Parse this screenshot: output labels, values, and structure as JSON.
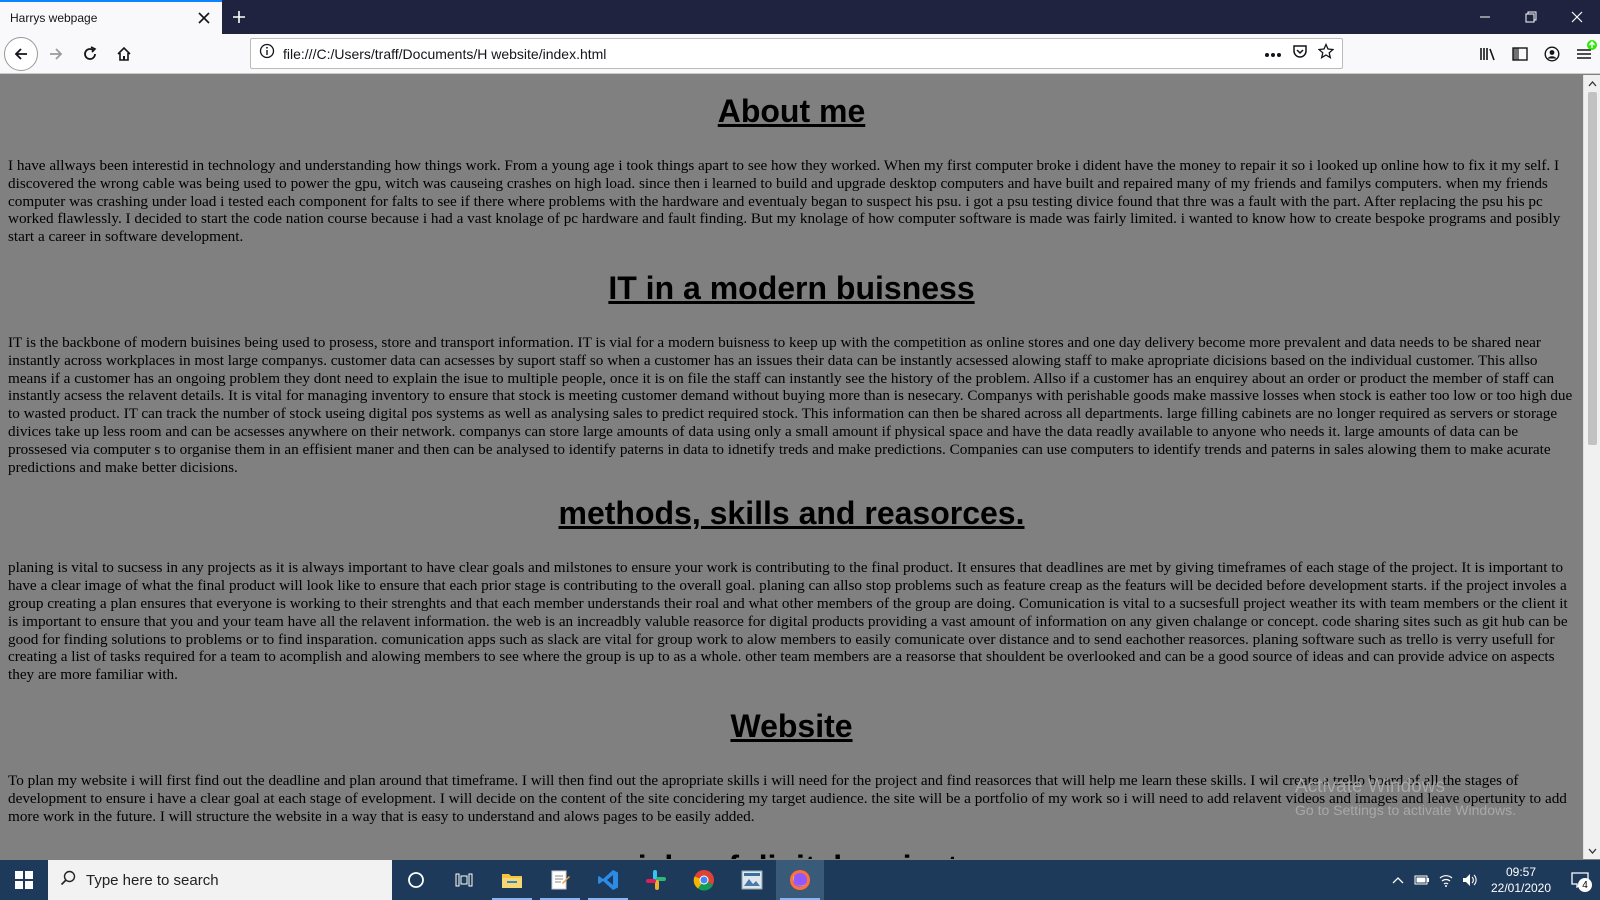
{
  "browser": {
    "tab_title": "Harrys webpage",
    "url": "file:///C:/Users/traff/Documents/H website/index.html"
  },
  "page": {
    "sections": [
      {
        "heading": "About me",
        "body": "I have allways been interestid in technology and understanding how things work. From a young age i took things apart to see how they worked. When my first computer broke i dident have the money to repair it so i looked up online how to fix it my self. I discovered the wrong cable was being used to power the gpu, witch was causeing crashes on high load. since then i learned to build and upgrade desktop computers and have built and repaired many of my friends and familys computers. when my friends computer was crashing under load i tested each component for falts to see if there where problems with the hardware and eventualy began to suspect his psu. i got a psu testing divice found that thre was a fault with the part. After replacing the psu his pc worked flawlessly. I decided to start the code nation course because i had a vast knolage of pc hardware and fault finding. But my knolage of how computer software is made was fairly limited. i wanted to know how to create bespoke programs and posibly start a career in software development."
      },
      {
        "heading": "IT in a modern buisness",
        "body": "IT is the backbone of modern buisines being used to prosess, store and transport information. IT is vial for a modern buisness to keep up with the competition as online stores and one day delivery become more prevalent and data needs to be shared near instantly across workplaces in most large companys. customer data can acsesses by suport staff so when a customer has an issues their data can be instantly acsessed alowing staff to make apropriate dicisions based on the individual customer. This allso means if a customer has an ongoing problem they dont need to explain the isue to multiple people, once it is on file the staff can instantly see the history of the problem. Allso if a customer has an enquirey about an order or product the member of staff can instantly acsess the relavent details. It is vital for managing inventory to ensure that stock is meeting customer demand without buying more than is nesecary. Companys with perishable goods make massive losses when stock is eather too low or too high due to wasted product. IT can track the number of stock useing digital pos systems as well as analysing sales to predict required stock. This information can then be shared across all departments. large filling cabinets are no longer required as servers or storage divices take up less room and can be acsesses anywhere on their network. companys can store large amounts of data using only a small amount if physical space and have the data readly available to anyone who needs it. large amounts of data can be prossesed via computer s to organise them in an effisient maner and then can be analysed to identify paterns in data to idnetify treds and make predictions. Companies can use computers to identify trends and paterns in sales alowing them to make acurate predictions and make better dicisions."
      },
      {
        "heading": "methods, skills and reasorces.",
        "body": "planing is vital to sucsess in any projects as it is always important to have clear goals and milstones to ensure your work is contributing to the final product. It ensures that deadlines are met by giving timeframes of each stage of the project. It is important to have a clear image of what the final product will look like to ensure that each prior stage is contributing to the overall goal. planing can allso stop problems such as feature creap as the featurs will be decided before development starts. if the project involes a group creating a plan ensures that everyone is working to their strenghts and that each member understands their roal and what other members of the group are doing. Comunication is vital to a sucsesfull project weather its with team members or the client it is important to ensure that you and your team have all the relavent information. the web is an increadbly valuble reasorce for digital products providing a vast amount of information on any given chalange or concept. code sharing sites such as git hub can be good for finding solutions to problems or to find insparation. comunication apps such as slack are vital for group work to alow members to easily comunicate over distance and to send eachother reasorces. planing software such as trello is verry usefull for creating a list of tasks required for a team to acomplish and alowing members to see where the group is up to as a whole. other team members are a reasorse that shouldent be overlooked and can be a good source of ideas and can provide advice on aspects they are more familiar with."
      },
      {
        "heading": "Website",
        "body": "To plan my website i will first find out the deadline and plan around that timeframe. I will then find out the apropriate skills i will need for the project and find reasorces that will help me learn these skills. I wil create a trello board of all the stages of development to ensure i have a clear goal at each stage of evelopment. I will decide on the content of the site concidering my target audience. the site will be a portfolio of my work so i will need to add relavent videos and images and leave opertunity to add more work in the future. I will structure the website in a way that is easy to understand and alows pages to be easily added."
      },
      {
        "heading": "risks of digital project"
      }
    ]
  },
  "watermark": {
    "title": "Activate Windows",
    "subtitle": "Go to Settings to activate Windows."
  },
  "taskbar": {
    "search_placeholder": "Type here to search",
    "time": "09:57",
    "date": "22/01/2020",
    "notification_count": "4"
  },
  "colors": {
    "page_background": "#808080",
    "tab_bar": "#202340",
    "taskbar": "#1e3a5a"
  }
}
